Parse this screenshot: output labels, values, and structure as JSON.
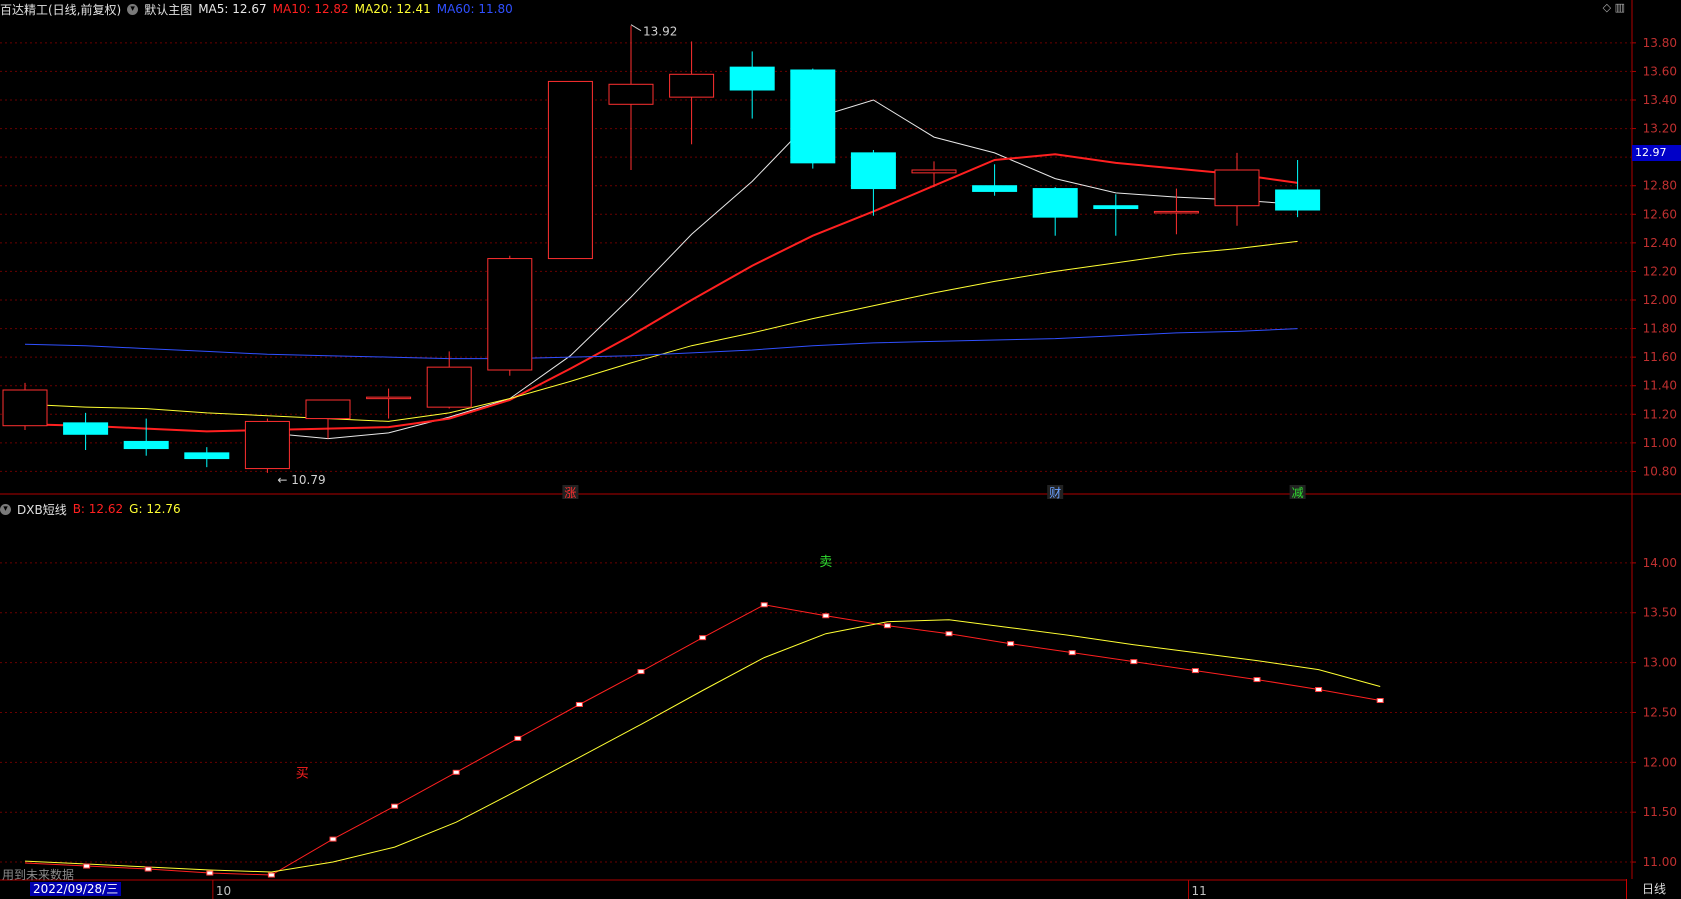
{
  "main_legend": {
    "title": "百达精工(日线,前复权)",
    "template": "默认主图",
    "items": [
      {
        "label": "MA5: 12.67",
        "color": "#e8e8e8"
      },
      {
        "label": "MA10: 12.82",
        "color": "#ff2020"
      },
      {
        "label": "MA20: 12.41",
        "color": "#ffff33"
      },
      {
        "label": "MA60: 11.80",
        "color": "#3050ff"
      }
    ]
  },
  "top_right_icons": "◇ ▥",
  "sub_legend": {
    "title": "DXB短线",
    "items": [
      {
        "label": "B: 12.62",
        "color": "#ff2020"
      },
      {
        "label": "G: 12.76",
        "color": "#ffff33"
      }
    ]
  },
  "price_tag": "12.97",
  "footer_note": "用到未来数据",
  "date_box": "2022/09/28/三",
  "period_tab": "日线",
  "chart_data": [
    {
      "type": "candlestick",
      "title": "百达精工(日线,前复权)",
      "y_ticks": [
        "13.80",
        "13.60",
        "13.40",
        "13.20",
        "13.00",
        "12.80",
        "12.60",
        "12.40",
        "12.20",
        "12.00",
        "11.80",
        "11.60",
        "11.40",
        "11.20",
        "11.00",
        "10.80"
      ],
      "ylim": [
        10.67,
        13.96
      ],
      "x_ticks": [
        "10",
        "11"
      ],
      "candles": [
        {
          "o": 11.12,
          "h": 11.42,
          "l": 11.09,
          "c": 11.37
        },
        {
          "o": 11.14,
          "h": 11.21,
          "l": 10.95,
          "c": 11.06
        },
        {
          "o": 11.01,
          "h": 11.17,
          "l": 10.91,
          "c": 10.96
        },
        {
          "o": 10.93,
          "h": 10.97,
          "l": 10.83,
          "c": 10.89
        },
        {
          "o": 10.82,
          "h": 11.17,
          "l": 10.79,
          "c": 11.15
        },
        {
          "o": 11.17,
          "h": 11.3,
          "l": 11.03,
          "c": 11.3
        },
        {
          "o": 11.32,
          "h": 11.38,
          "l": 11.17,
          "c": 11.32
        },
        {
          "o": 11.25,
          "h": 11.64,
          "l": 11.24,
          "c": 11.53
        },
        {
          "o": 11.51,
          "h": 12.31,
          "l": 11.47,
          "c": 12.29
        },
        {
          "o": 12.29,
          "h": 13.53,
          "l": 12.29,
          "c": 13.53
        },
        {
          "o": 13.37,
          "h": 13.92,
          "l": 12.91,
          "c": 13.51
        },
        {
          "o": 13.42,
          "h": 13.81,
          "l": 13.09,
          "c": 13.58
        },
        {
          "o": 13.63,
          "h": 13.74,
          "l": 13.27,
          "c": 13.47
        },
        {
          "o": 13.61,
          "h": 13.62,
          "l": 12.92,
          "c": 12.96
        },
        {
          "o": 13.03,
          "h": 13.05,
          "l": 12.59,
          "c": 12.78
        },
        {
          "o": 12.89,
          "h": 12.97,
          "l": 12.79,
          "c": 12.91
        },
        {
          "o": 12.8,
          "h": 12.95,
          "l": 12.73,
          "c": 12.76
        },
        {
          "o": 12.78,
          "h": 12.79,
          "l": 12.45,
          "c": 12.58
        },
        {
          "o": 12.66,
          "h": 12.74,
          "l": 12.45,
          "c": 12.64
        },
        {
          "o": 12.62,
          "h": 12.78,
          "l": 12.46,
          "c": 12.62
        },
        {
          "o": 12.66,
          "h": 13.03,
          "l": 12.52,
          "c": 12.91
        },
        {
          "o": 12.77,
          "h": 12.98,
          "l": 12.58,
          "c": 12.63
        }
      ],
      "series": [
        {
          "name": "MA5",
          "color": "#e8e8e8",
          "width": 1,
          "values": [
            null,
            null,
            null,
            null,
            11.07,
            11.03,
            11.07,
            11.18,
            11.31,
            11.61,
            12.02,
            12.46,
            12.83,
            13.27,
            13.4,
            13.14,
            13.03,
            12.85,
            12.75,
            12.72,
            12.7,
            12.67
          ]
        },
        {
          "name": "MA10",
          "color": "#ff2020",
          "width": 2,
          "values": [
            11.13,
            11.12,
            11.1,
            11.08,
            11.09,
            11.1,
            11.11,
            11.17,
            11.3,
            11.52,
            11.75,
            12.0,
            12.24,
            12.45,
            12.62,
            12.8,
            12.98,
            13.02,
            12.96,
            12.92,
            12.88,
            12.82
          ]
        },
        {
          "name": "MA20",
          "color": "#ffff33",
          "width": 1,
          "values": [
            11.27,
            11.25,
            11.24,
            11.21,
            11.19,
            11.17,
            11.15,
            11.21,
            11.31,
            11.43,
            11.56,
            11.68,
            11.77,
            11.87,
            11.96,
            12.05,
            12.13,
            12.2,
            12.26,
            12.32,
            12.36,
            12.41
          ]
        },
        {
          "name": "MA60",
          "color": "#3050ff",
          "width": 1,
          "values": [
            11.69,
            11.68,
            11.66,
            11.64,
            11.62,
            11.61,
            11.6,
            11.59,
            11.59,
            11.6,
            11.61,
            11.63,
            11.65,
            11.68,
            11.7,
            11.71,
            11.72,
            11.73,
            11.75,
            11.77,
            11.78,
            11.8
          ]
        }
      ],
      "annotations": [
        {
          "text": "13.92",
          "index": 10,
          "value": 13.92,
          "kind": "high"
        },
        {
          "text": "10.79",
          "index": 4,
          "value": 10.79,
          "kind": "low"
        }
      ],
      "markers": [
        {
          "text": "涨",
          "index": 9,
          "color": "#ff3030"
        },
        {
          "text": "财",
          "index": 17,
          "color": "#6aa0ff"
        },
        {
          "text": "减",
          "index": 21,
          "color": "#30dd30"
        }
      ]
    },
    {
      "type": "line",
      "title": "DXB短线",
      "y_ticks": [
        "14.00",
        "13.50",
        "13.00",
        "12.50",
        "12.00",
        "11.50",
        "11.00"
      ],
      "ylim": [
        10.82,
        14.43
      ],
      "series": [
        {
          "name": "B",
          "color": "#ff2020",
          "values": [
            10.99,
            10.96,
            10.93,
            10.89,
            10.87,
            11.23,
            11.56,
            11.9,
            12.24,
            12.58,
            12.91,
            13.25,
            13.58,
            13.47,
            13.37,
            13.29,
            13.19,
            13.1,
            13.01,
            12.92,
            12.83,
            12.73,
            12.62
          ]
        },
        {
          "name": "G",
          "color": "#ffff33",
          "values": [
            11.01,
            10.98,
            10.95,
            10.92,
            10.9,
            11.0,
            11.15,
            11.4,
            11.72,
            12.05,
            12.38,
            12.72,
            13.05,
            13.29,
            13.41,
            13.43,
            13.35,
            13.27,
            13.18,
            13.1,
            13.02,
            12.93,
            12.76
          ]
        }
      ],
      "labels": [
        {
          "text": "买",
          "index": 4.5,
          "value": 11.9,
          "color": "#ff2020"
        },
        {
          "text": "卖",
          "index": 13,
          "value": 14.02,
          "color": "#30dd30"
        }
      ]
    }
  ]
}
